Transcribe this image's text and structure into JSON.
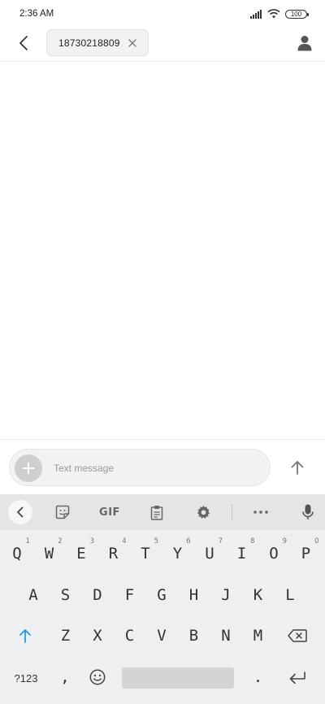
{
  "status_bar": {
    "time": "2:36 AM",
    "battery": "100",
    "icons": [
      "signal-icon",
      "wifi-icon",
      "battery-icon"
    ]
  },
  "header": {
    "recipient": "18730218809",
    "icons": [
      "back-arrow-icon",
      "close-icon",
      "contact-person-icon"
    ]
  },
  "compose": {
    "placeholder": "Text message",
    "value": "",
    "icons": [
      "plus-icon",
      "send-arrow-icon"
    ]
  },
  "keyboard": {
    "toolbar": {
      "gif_label": "GIF",
      "icons": [
        "chevron-left-icon",
        "sticker-icon",
        "clipboard-icon",
        "gear-icon",
        "more-icon",
        "microphone-icon"
      ]
    },
    "rows": [
      [
        {
          "label": "Q",
          "hint": "1"
        },
        {
          "label": "W",
          "hint": "2"
        },
        {
          "label": "E",
          "hint": "3"
        },
        {
          "label": "R",
          "hint": "4"
        },
        {
          "label": "T",
          "hint": "5"
        },
        {
          "label": "Y",
          "hint": "6"
        },
        {
          "label": "U",
          "hint": "7"
        },
        {
          "label": "I",
          "hint": "8"
        },
        {
          "label": "O",
          "hint": "9"
        },
        {
          "label": "P",
          "hint": "0"
        }
      ],
      [
        {
          "label": "A"
        },
        {
          "label": "S"
        },
        {
          "label": "D"
        },
        {
          "label": "F"
        },
        {
          "label": "G"
        },
        {
          "label": "H"
        },
        {
          "label": "J"
        },
        {
          "label": "K"
        },
        {
          "label": "L"
        }
      ],
      [
        {
          "label": "Z"
        },
        {
          "label": "X"
        },
        {
          "label": "C"
        },
        {
          "label": "V"
        },
        {
          "label": "B"
        },
        {
          "label": "N"
        },
        {
          "label": "M"
        }
      ]
    ],
    "bottom_row": {
      "symbols_label": "?123",
      "comma_label": ",",
      "period_label": "."
    },
    "accent_color": "#2196f3"
  }
}
